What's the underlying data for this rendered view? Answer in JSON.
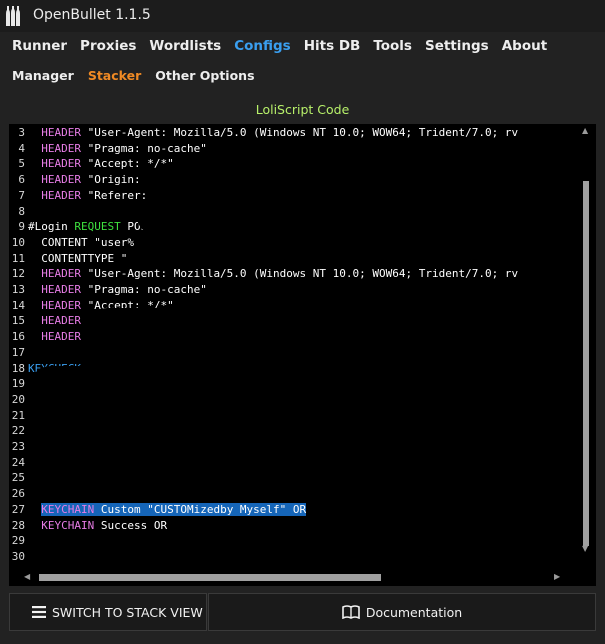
{
  "app": {
    "title": "OpenBullet 1.1.5"
  },
  "nav": {
    "items": [
      "Runner",
      "Proxies",
      "Wordlists",
      "Configs",
      "Hits DB",
      "Tools",
      "Settings",
      "About"
    ],
    "active": "Configs"
  },
  "subnav": {
    "items": [
      "Manager",
      "Stacker",
      "Other Options"
    ],
    "active": "Stacker"
  },
  "editor": {
    "title": "LoliScript Code",
    "lines": [
      {
        "n": "3",
        "segs": [
          [
            "h",
            "  HEADER "
          ],
          [
            "p",
            "\"User-Agent: Mozilla/5.0 (Windows NT 10.0; WOW64; Trident/7.0; rv"
          ]
        ]
      },
      {
        "n": "4",
        "segs": [
          [
            "h",
            "  HEADER "
          ],
          [
            "p",
            "\"Pragma: no-cache\""
          ]
        ]
      },
      {
        "n": "5",
        "segs": [
          [
            "h",
            "  HEADER "
          ],
          [
            "p",
            "\"Accept: */*\""
          ]
        ]
      },
      {
        "n": "6",
        "segs": [
          [
            "h",
            "  HEADER "
          ],
          [
            "p",
            "\"Origin: "
          ]
        ]
      },
      {
        "n": "7",
        "segs": [
          [
            "h",
            "  HEADER "
          ],
          [
            "p",
            "\"Referer:"
          ]
        ]
      },
      {
        "n": "8",
        "segs": []
      },
      {
        "n": "9",
        "segs": [
          [
            "p",
            "#Login "
          ],
          [
            "g",
            "REQUEST"
          ],
          [
            "p",
            " POST"
          ]
        ]
      },
      {
        "n": "10",
        "segs": [
          [
            "p",
            "  CONTENT \"user%"
          ]
        ]
      },
      {
        "n": "11",
        "segs": [
          [
            "p",
            "  CONTENTTYPE \""
          ]
        ]
      },
      {
        "n": "12",
        "segs": [
          [
            "h",
            "  HEADER "
          ],
          [
            "p",
            "\"User-Agent: Mozilla/5.0 (Windows NT 10.0; WOW64; Trident/7.0; rv"
          ]
        ]
      },
      {
        "n": "13",
        "segs": [
          [
            "h",
            "  HEADER "
          ],
          [
            "p",
            "\"Pragma: no-cache\""
          ]
        ]
      },
      {
        "n": "14",
        "segs": [
          [
            "h",
            "  HEADER "
          ],
          [
            "p",
            "\"Accept: */*\""
          ]
        ]
      },
      {
        "n": "15",
        "segs": [
          [
            "h",
            "  HEADER "
          ]
        ]
      },
      {
        "n": "16",
        "segs": [
          [
            "h",
            "  HEADER "
          ]
        ]
      },
      {
        "n": "17",
        "segs": []
      },
      {
        "n": "18",
        "segs": [
          [
            "b",
            "KEYCHECK"
          ]
        ]
      },
      {
        "n": "19",
        "segs": []
      },
      {
        "n": "20",
        "segs": []
      },
      {
        "n": "21",
        "segs": []
      },
      {
        "n": "22",
        "segs": []
      },
      {
        "n": "23",
        "segs": []
      },
      {
        "n": "24",
        "segs": []
      },
      {
        "n": "25",
        "segs": []
      },
      {
        "n": "26",
        "segs": []
      },
      {
        "n": "27",
        "sel": true,
        "segs": [
          [
            "h",
            "  KEYCHAIN "
          ],
          [
            "p",
            "Custom \"CUSTOMizedby Myself\" OR"
          ]
        ]
      },
      {
        "n": "28",
        "segs": [
          [
            "h",
            "  KEYCHAIN "
          ],
          [
            "p",
            "Success OR"
          ]
        ]
      },
      {
        "n": "29",
        "segs": []
      },
      {
        "n": "30",
        "segs": []
      }
    ]
  },
  "buttons": {
    "stack_view": "SWITCH TO STACK VIEW",
    "documentation": "Documentation"
  },
  "icons": {
    "logo": "bottles-logo-icon",
    "stack": "hamburger-icon",
    "docs": "book-icon"
  },
  "colors": {
    "accent_blue": "#3a9ff0",
    "accent_orange": "#f08a24",
    "title_green": "#b7f06a",
    "keyword_header": "#e77de6",
    "keyword_request": "#3ee03e",
    "keyword_keycheck": "#3a9ff0",
    "selection": "#1565b8"
  }
}
